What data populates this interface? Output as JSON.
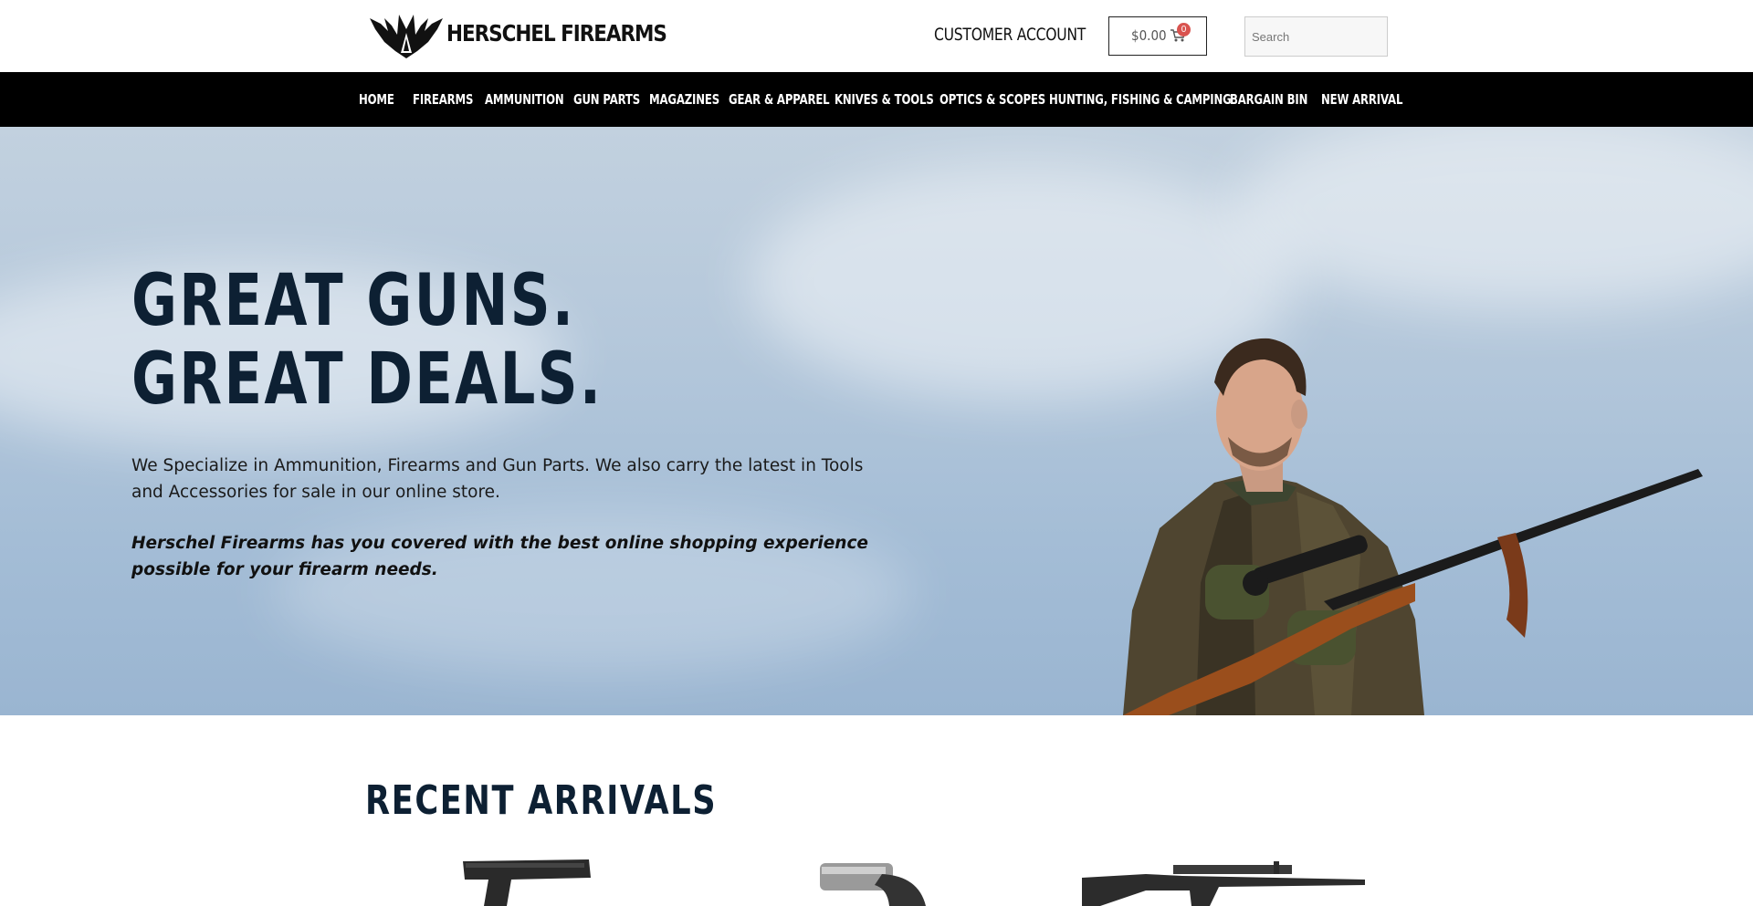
{
  "header": {
    "brand_name": "HERSCHEL FIREARMS",
    "logo_icon": "winged-badge-logo",
    "account_label": "CUSTOMER ACCOUNT",
    "cart_total": "$0.00",
    "cart_count": "0",
    "cart_icon": "shopping-cart-icon",
    "search_placeholder": "Search"
  },
  "nav": {
    "items": [
      {
        "label": "HOME"
      },
      {
        "label": "FIREARMS"
      },
      {
        "label": "AMMUNITION"
      },
      {
        "label": "GUN PARTS"
      },
      {
        "label": "MAGAZINES"
      },
      {
        "label": "GEAR & APPAREL"
      },
      {
        "label": "KNIVES & TOOLS"
      },
      {
        "label": "OPTICS & SCOPES"
      },
      {
        "label": "HUNTING, FISHING & CAMPING"
      },
      {
        "label": "BARGAIN BIN"
      },
      {
        "label": "NEW ARRIVAL"
      }
    ]
  },
  "hero": {
    "title_line1": "GREAT GUNS.",
    "title_line2": "GREAT DEALS.",
    "description": "We Specialize in Ammunition, Firearms and Gun Parts. We also carry the latest in Tools and Accessories for sale in our online store.",
    "tagline": "Herschel Firearms has you covered with the best online shopping experience possible for your firearm needs."
  },
  "recent": {
    "title": "RECENT ARRIVALS"
  },
  "colors": {
    "nav_bg": "#000000",
    "heading": "#0d2033",
    "badge": "#d9534f",
    "sky": "#b5c8db"
  }
}
